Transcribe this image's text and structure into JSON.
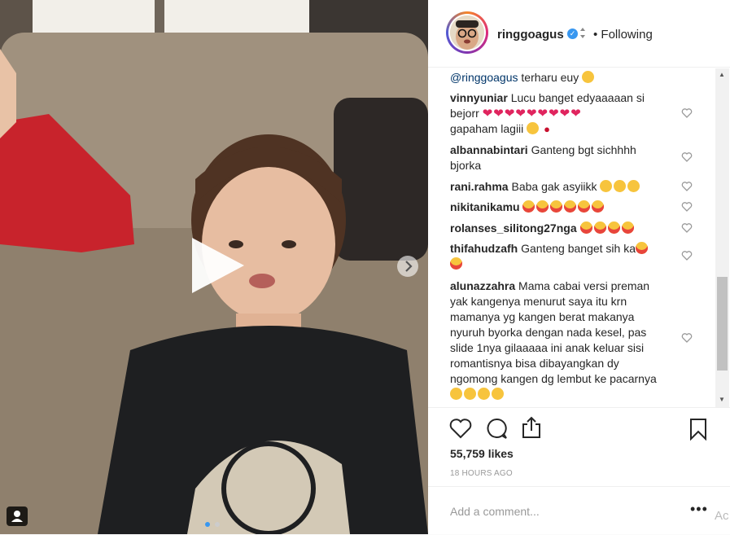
{
  "post": {
    "username": "ringgoagus",
    "follow_status": "• Following",
    "likes": "55,759 likes",
    "time": "18 HOURS AGO",
    "add_comment_placeholder": "Add a comment...",
    "more": "•••",
    "verified_mark": "✓"
  },
  "comments": [
    {
      "user": "",
      "mention": "@ringgoagus",
      "text": " terharu euy",
      "emoji": [
        "sad"
      ]
    },
    {
      "user": "vinnyuniar",
      "text_a": "Lucu banget edyaaaaan si bejorr ",
      "text_b": "gapaham lagiii ",
      "hearts": 9
    },
    {
      "user": "albannabintari",
      "text": "Ganteng bgt sichhhh bjorka"
    },
    {
      "user": "rani.rahma",
      "text": "Baba gak asyiikk "
    },
    {
      "user": "nikitanikamu",
      "text": ""
    },
    {
      "user": "rolanses_silitong27nga",
      "text": ""
    },
    {
      "user": "thifahudzafh",
      "text": "Ganteng banget sih ka"
    },
    {
      "user": "alunazzahra",
      "text": "Mama cabai versi preman yak kangenya menurut saya itu krn mamanya yg kangen berat makanya nyuruh byorka dengan nada kesel, pas slide 1nya gilaaaaa ini anak keluar sisi romantisnya bisa dibayangkan dy ngomong kangen dg lembut ke pacarnya "
    }
  ],
  "icons": {
    "like": "heart-outline-icon",
    "comment": "speech-bubble-icon",
    "share": "share-icon",
    "save": "bookmark-icon",
    "play": "play-icon",
    "next": "chevron-right-icon",
    "user_tag": "person-icon"
  },
  "colors": {
    "link": "#003569",
    "verified": "#3897f0",
    "heart": "#ed4956",
    "text": "#262626",
    "muted": "#999999"
  },
  "media": {
    "carousel_count": 2,
    "carousel_active": 1
  },
  "edge_text": "Ac"
}
